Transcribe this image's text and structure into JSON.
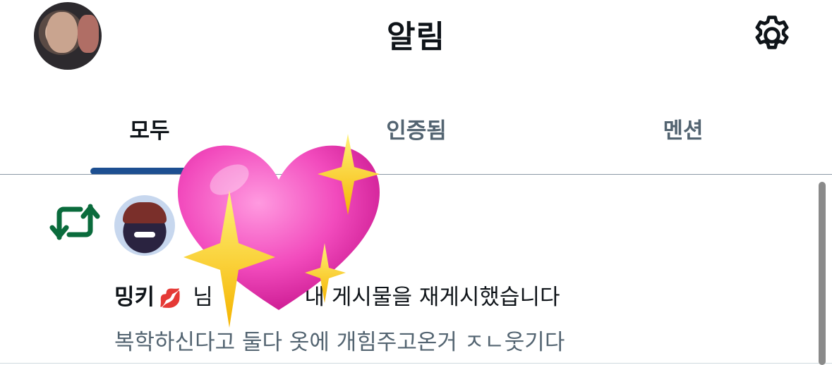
{
  "header": {
    "title": "알림",
    "avatar_icon": "profile-photo",
    "settings_icon": "gear-icon"
  },
  "tabs": [
    {
      "label": "모두",
      "active": true
    },
    {
      "label": "인증됨",
      "active": false
    },
    {
      "label": "멘션",
      "active": false
    }
  ],
  "notification": {
    "type_icon": "retweet-icon",
    "user_name": "밍키",
    "name_emoji": "💋",
    "action_text_visible_start": "님",
    "action_text_visible_end": "내 게시물을 재게시했습니다",
    "preview": "복학하신다고 둘다 옷에 개힘주고온거 ㅈㄴ웃기다"
  },
  "overlay": {
    "sticker": "sparkling-heart-sticker"
  },
  "colors": {
    "active_indicator": "#1d4f91",
    "retweet_green": "#0a6b3c",
    "muted_text": "#536471"
  }
}
